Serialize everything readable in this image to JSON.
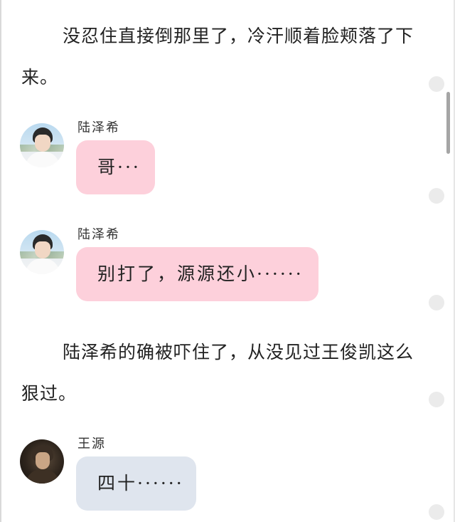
{
  "narration": [
    {
      "text": "没忍住直接倒那里了，冷汗顺着脸颊落了下来。"
    },
    {
      "text": "陆泽希的确被吓住了，从没见过王俊凯这么狠过。"
    }
  ],
  "messages": [
    {
      "sender": "陆泽希",
      "text": "哥···",
      "bubble_color": "#fdd0db",
      "avatar": "boy-avatar"
    },
    {
      "sender": "陆泽希",
      "text": "别打了，源源还小······",
      "bubble_color": "#fdd0db",
      "avatar": "boy-avatar"
    },
    {
      "sender": "王源",
      "text": "四十······",
      "bubble_color": "#dfe5ee",
      "avatar": "singer-avatar"
    }
  ],
  "colors": {
    "pink_bubble": "#fdd0db",
    "gray_bubble": "#dfe5ee",
    "scrollbar": "#a5a5a5"
  }
}
